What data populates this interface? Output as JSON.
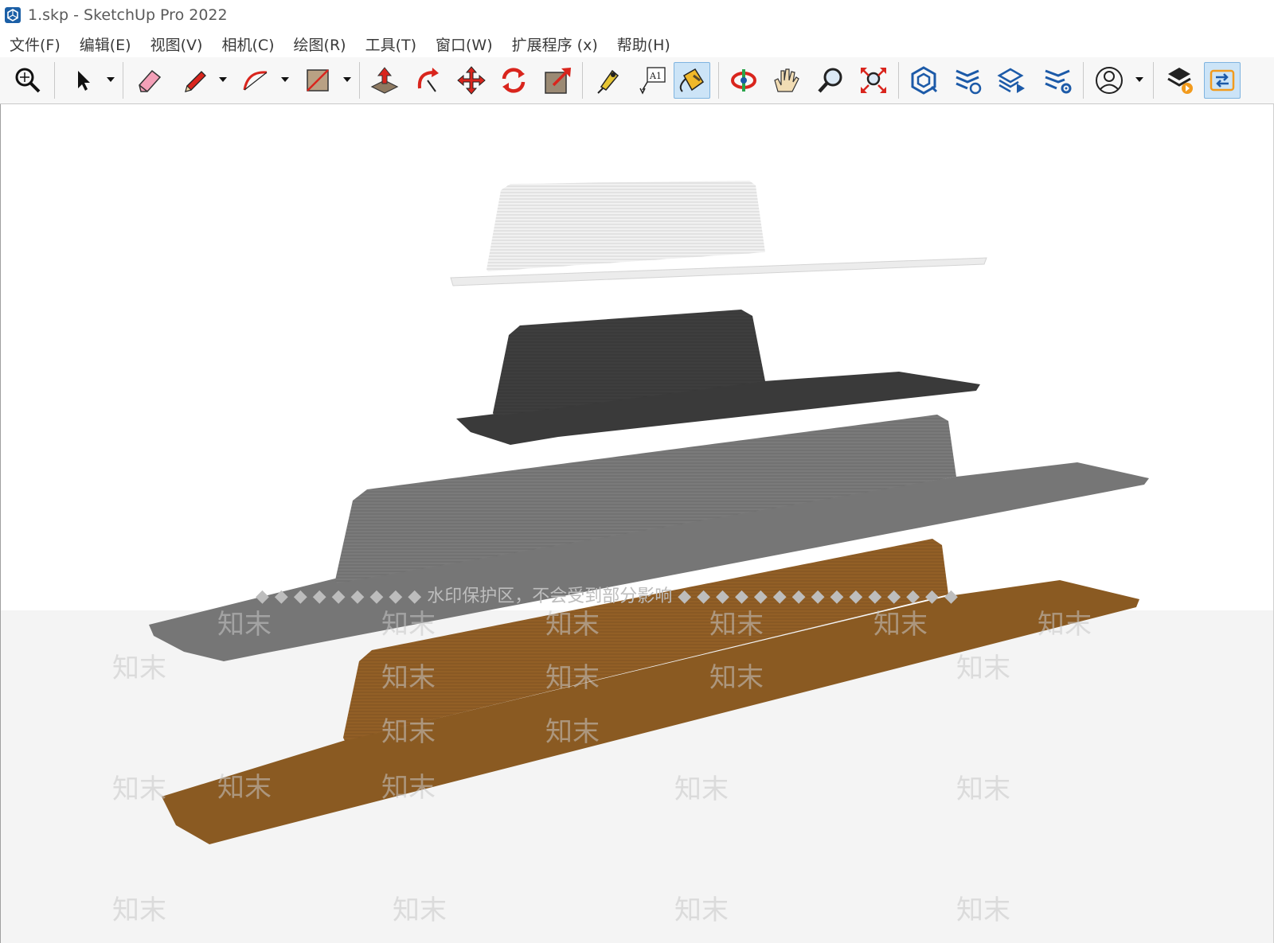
{
  "window": {
    "title": "1.skp - SketchUp Pro 2022",
    "app_icon": "sketchup-logo-icon"
  },
  "menu": [
    {
      "label": "文件(F)"
    },
    {
      "label": "编辑(E)"
    },
    {
      "label": "视图(V)"
    },
    {
      "label": "相机(C)"
    },
    {
      "label": "绘图(R)"
    },
    {
      "label": "工具(T)"
    },
    {
      "label": "窗口(W)"
    },
    {
      "label": "扩展程序 (x)"
    },
    {
      "label": "帮助(H)"
    }
  ],
  "toolbar": {
    "tools": [
      {
        "icon": "zoom-extents-icon"
      },
      {
        "icon": "select-arrow-icon"
      },
      {
        "icon": "eraser-icon"
      },
      {
        "icon": "pencil-line-icon"
      },
      {
        "icon": "arc-icon"
      },
      {
        "icon": "rectangle-icon"
      },
      {
        "icon": "push-pull-icon"
      },
      {
        "icon": "follow-me-icon"
      },
      {
        "icon": "move-icon"
      },
      {
        "icon": "rotate-icon"
      },
      {
        "icon": "scale-icon"
      },
      {
        "icon": "tape-measure-icon"
      },
      {
        "icon": "text-label-icon",
        "text": "A1"
      },
      {
        "icon": "paint-bucket-icon",
        "active": true
      },
      {
        "icon": "orbit-icon"
      },
      {
        "icon": "pan-hand-icon"
      },
      {
        "icon": "zoom-magnifier-icon"
      },
      {
        "icon": "zoom-extents-arrows-icon"
      },
      {
        "icon": "3d-warehouse-icon"
      },
      {
        "icon": "extension-warehouse-icon"
      },
      {
        "icon": "layout-send-icon"
      },
      {
        "icon": "extension-manager-icon"
      },
      {
        "icon": "account-profile-icon"
      },
      {
        "icon": "trimble-connect-icon"
      },
      {
        "icon": "share-model-icon"
      }
    ]
  },
  "viewport": {
    "watermark_notice": "◆ ◆ ◆ ◆ ◆ ◆ ◆ ◆ ◆ 水印保护区，不会受到部分影响 ◆ ◆ ◆ ◆ ◆ ◆ ◆ ◆ ◆ ◆ ◆ ◆ ◆ ◆ ◆",
    "watermark_text": "知末",
    "colors": {
      "model_white": "#e9e9e9",
      "model_black": "#3a3a3a",
      "model_gray": "#727272",
      "model_wood": "#8a5a22"
    }
  }
}
